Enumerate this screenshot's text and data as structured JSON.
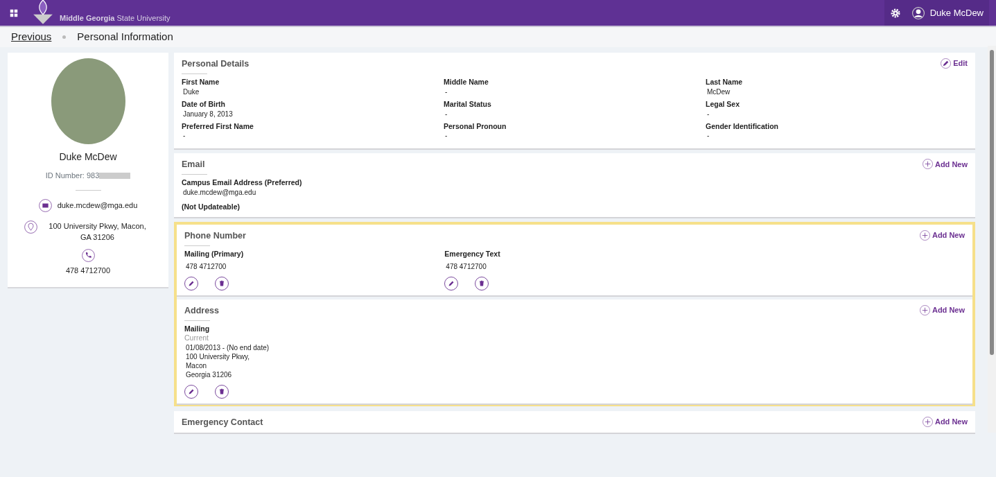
{
  "header": {
    "logo_text": "Middle Georgia",
    "logo_subtext": "State University",
    "user_name": "Duke McDew"
  },
  "breadcrumb": {
    "previous": "Previous",
    "current": "Personal Information"
  },
  "profile": {
    "name": "Duke McDew",
    "id_label": "ID Number: 983",
    "email": "duke.mcdew@mga.edu",
    "address": "100 University Pkwy, Macon, GA 31206",
    "phone": "478 4712700"
  },
  "sections": [
    {
      "kind": "details",
      "title": "Personal Details",
      "highlighted": false,
      "action": {
        "kind": "edit",
        "label": "Edit"
      },
      "fields": [
        {
          "label": "First Name",
          "value": "Duke"
        },
        {
          "label": "Middle Name",
          "value": "-"
        },
        {
          "label": "Last Name",
          "value": "McDew"
        },
        {
          "label": "Date of Birth",
          "value": "January 8, 2013"
        },
        {
          "label": "Marital Status",
          "value": "-"
        },
        {
          "label": "Legal Sex",
          "value": "-"
        },
        {
          "label": "Preferred First Name",
          "value": "-"
        },
        {
          "label": "Personal Pronoun",
          "value": "-"
        },
        {
          "label": "Gender Identification",
          "value": "-"
        }
      ]
    },
    {
      "kind": "email",
      "title": "Email",
      "highlighted": false,
      "action": {
        "kind": "add",
        "label": "Add New"
      },
      "items": [
        {
          "label": "Campus Email Address (Preferred)",
          "value": "duke.mcdew@mga.edu",
          "note": "(Not Updateable)"
        }
      ]
    },
    {
      "kind": "phone",
      "title": "Phone Number",
      "highlighted": true,
      "action": {
        "kind": "add",
        "label": "Add New"
      },
      "items": [
        {
          "label": "Mailing (Primary)",
          "value": "478 4712700"
        },
        {
          "label": "Emergency Text",
          "value": "478 4712700"
        }
      ]
    },
    {
      "kind": "address",
      "title": "Address",
      "highlighted": true,
      "action": {
        "kind": "add",
        "label": "Add New"
      },
      "items": [
        {
          "label": "Mailing",
          "status": "Current",
          "lines": [
            "01/08/2013 - (No end date)",
            "100 University Pkwy,",
            "Macon",
            "Georgia 31206"
          ]
        }
      ]
    },
    {
      "kind": "empty",
      "title": "Emergency Contact",
      "highlighted": false,
      "action": {
        "kind": "add",
        "label": "Add New"
      }
    }
  ]
}
